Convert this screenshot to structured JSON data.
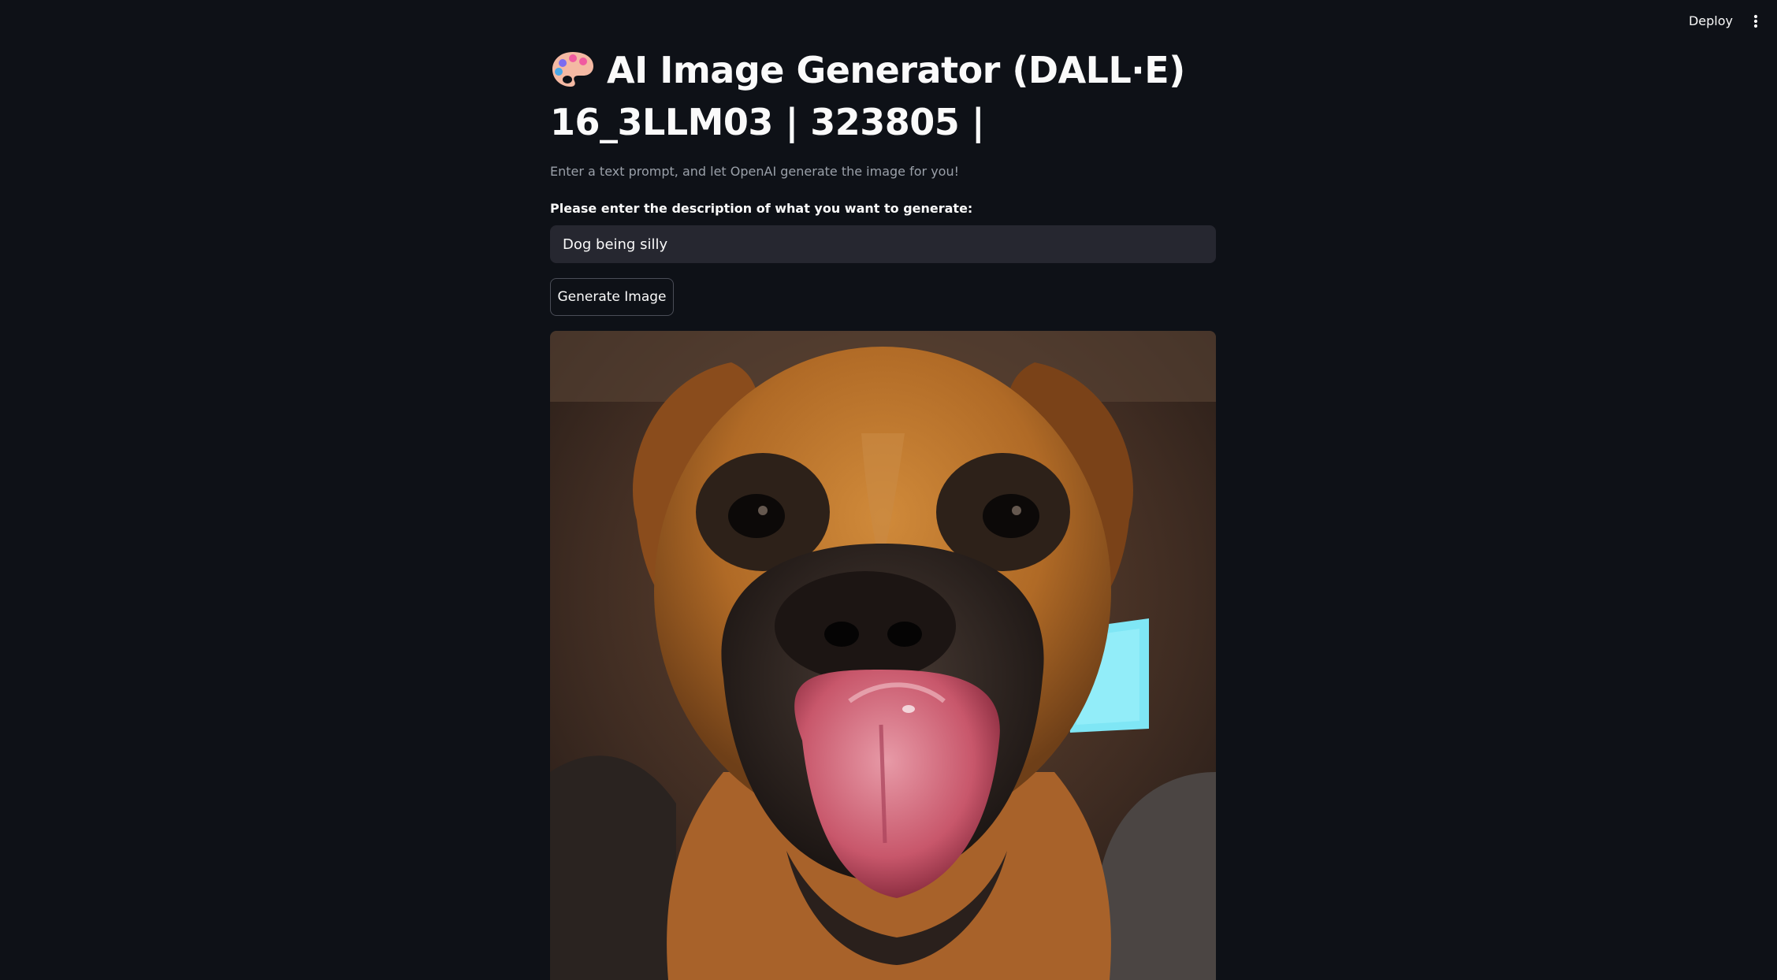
{
  "header": {
    "deploy_label": "Deploy",
    "menu_icon": "vertical-ellipsis-icon"
  },
  "main": {
    "title_icon": "artist-palette-icon",
    "title_line1": "AI Image Generator (DALL·E)",
    "title_line2": "16_3LLM03 | 323805 |",
    "subtitle": "Enter a text prompt, and let OpenAI generate the image for you!",
    "prompt_label": "Please enter the description of what you want to generate:",
    "prompt_value": "Dog being silly",
    "generate_label": "Generate Image",
    "result_image": "generated image of a boxer dog licking its nose"
  },
  "colors": {
    "background": "#0e1117",
    "input_background": "#262730",
    "text": "#fafafa",
    "muted_text": "#9aa0a9"
  }
}
